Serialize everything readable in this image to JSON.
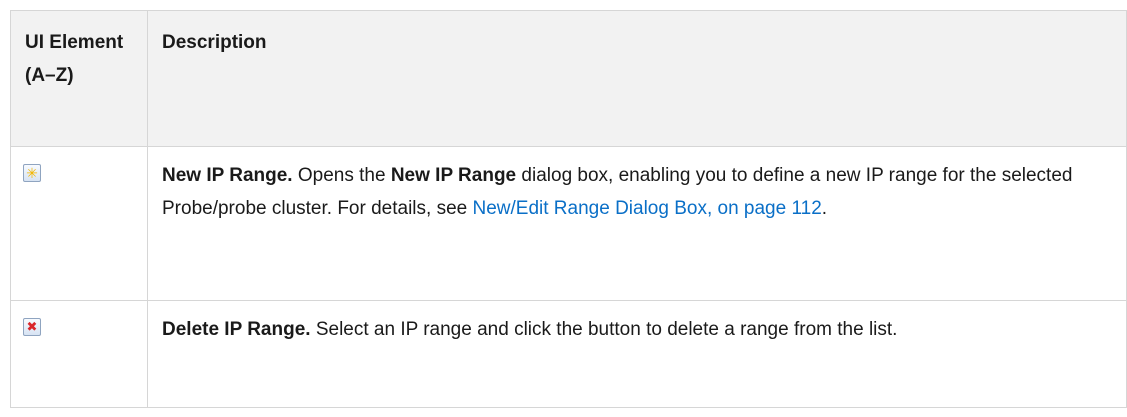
{
  "table": {
    "headers": {
      "ui_element": "UI Element (A–Z)",
      "description": "Description"
    },
    "rows": [
      {
        "icon": "new-ip-range-icon",
        "title": "New IP Range.",
        "text1": " Opens the ",
        "bold2": "New IP Range",
        "text2": " dialog box, enabling you to define a new IP range for the selected Probe/probe cluster. For details, see ",
        "link": "New/Edit Range Dialog Box, on page 112",
        "text3": "."
      },
      {
        "icon": "delete-ip-range-icon",
        "title": "Delete IP Range.",
        "text1": " Select an IP range and click the button to delete a range from the list."
      }
    ]
  },
  "colors": {
    "link": "#0a6fc7",
    "header_bg": "#f2f2f2",
    "border": "#d6d6d6"
  }
}
